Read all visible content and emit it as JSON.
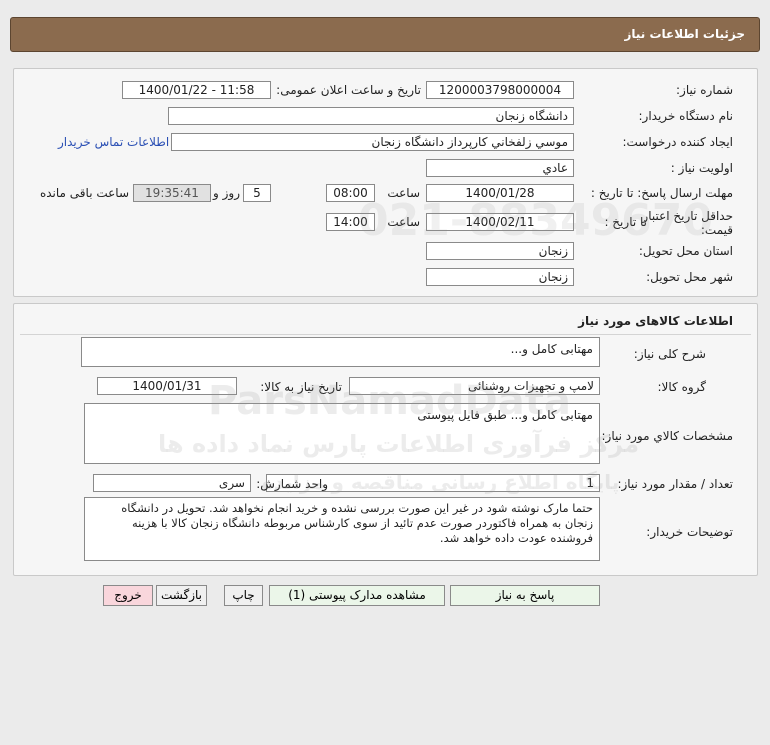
{
  "header": {
    "title": "جزئیات اطلاعات نیاز"
  },
  "need_info": {
    "need_number_label": "شماره نیاز:",
    "need_number": "1200003798000004",
    "announce_label": "تاریخ و ساعت اعلان عمومی:",
    "announce_value": "1400/01/22 - 11:58",
    "buyer_org_label": "نام دستگاه خریدار:",
    "buyer_org": "دانشگاه زنجان",
    "requester_label": "ایجاد کننده درخواست:",
    "requester": "موسي زلفخاني كارپرداز دانشگاه زنجان",
    "contact_link": "اطلاعات تماس خریدار",
    "priority_label": "اولویت نیاز :",
    "priority": "عادي",
    "deadline_label": "مهلت ارسال پاسخ: تا تاریخ :",
    "deadline_date": "1400/01/28",
    "time_label": "ساعت",
    "deadline_time": "08:00",
    "days_value": "5",
    "days_label": "روز و",
    "remaining_time": "19:35:41",
    "remaining_label": "ساعت باقی مانده",
    "validity_label": "حداقل تاریخ اعتبار قیمت:",
    "validity_to_label": "تا تاریخ :",
    "validity_date": "1400/02/11",
    "validity_time_label": "ساعت",
    "validity_time": "14:00",
    "province_label": "استان محل تحویل:",
    "province": "زنجان",
    "city_label": "شهر محل تحویل:",
    "city": "زنجان"
  },
  "goods": {
    "section_title": "اطلاعات کالاهای مورد نیاز",
    "summary_label": "شرح کلی نیاز:",
    "summary": "مهتابی کامل و...",
    "group_label": "گروه کالا:",
    "group": "لامپ و تجهیزات روشنائی",
    "need_date_label": "تاریخ نیاز به کالا:",
    "need_date": "1400/01/31",
    "specs_label": "مشخصات كالاي مورد نياز:",
    "specs": "مهتابی کامل و... طبق فایل پیوستی",
    "qty_label": "تعداد / مقدار مورد نیاز:",
    "qty": "1",
    "unit_label": "واحد شمارش:",
    "unit": "سری",
    "notes_label": "توضیحات خریدار:",
    "notes": "حتما مارک نوشته شود در غیر این صورت بررسی نشده و خرید انجام نخواهد شد. تحویل در دانشگاه زنجان به همراه فاکتوردر صورت عدم تائید از سوی کارشناس مربوطه دانشگاه زنجان کالا با هزینه فروشنده عودت داده خواهد شد."
  },
  "buttons": {
    "reply": "پاسخ به نیاز",
    "attachments": "مشاهده مدارک پیوستی (1)",
    "print": "چاپ",
    "back": "بازگشت",
    "exit": "خروج"
  },
  "watermark": {
    "number": "021-88349670",
    "brand": "ParsNamadData",
    "fa_line1": "مرکز فرآوری اطلاعات پارس نماد داده ها",
    "fa_line2": "پایگاه اطلاع رسانی مناقصه و مزایده"
  }
}
